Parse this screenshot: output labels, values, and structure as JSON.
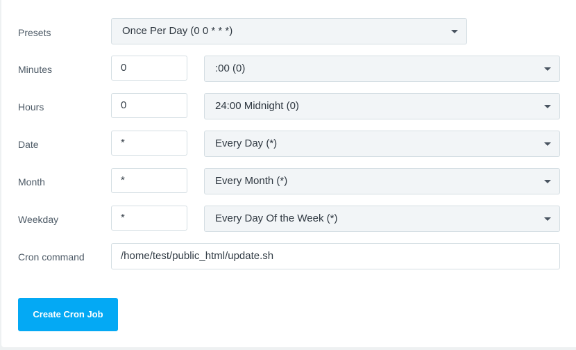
{
  "presets": {
    "label": "Presets",
    "selected": "Once Per Day (0 0 * * *)"
  },
  "fields": [
    {
      "label": "Minutes",
      "value": "0",
      "selected": ":00 (0)"
    },
    {
      "label": "Hours",
      "value": "0",
      "selected": "24:00 Midnight (0)"
    },
    {
      "label": "Date",
      "value": "*",
      "selected": "Every Day (*)"
    },
    {
      "label": "Month",
      "value": "*",
      "selected": "Every Month (*)"
    },
    {
      "label": "Weekday",
      "value": "*",
      "selected": "Every Day Of the Week (*)"
    }
  ],
  "command": {
    "label": "Cron command",
    "value": "/home/test/public_html/update.sh"
  },
  "submit_label": "Create Cron Job",
  "colors": {
    "accent": "#04a9f4"
  }
}
